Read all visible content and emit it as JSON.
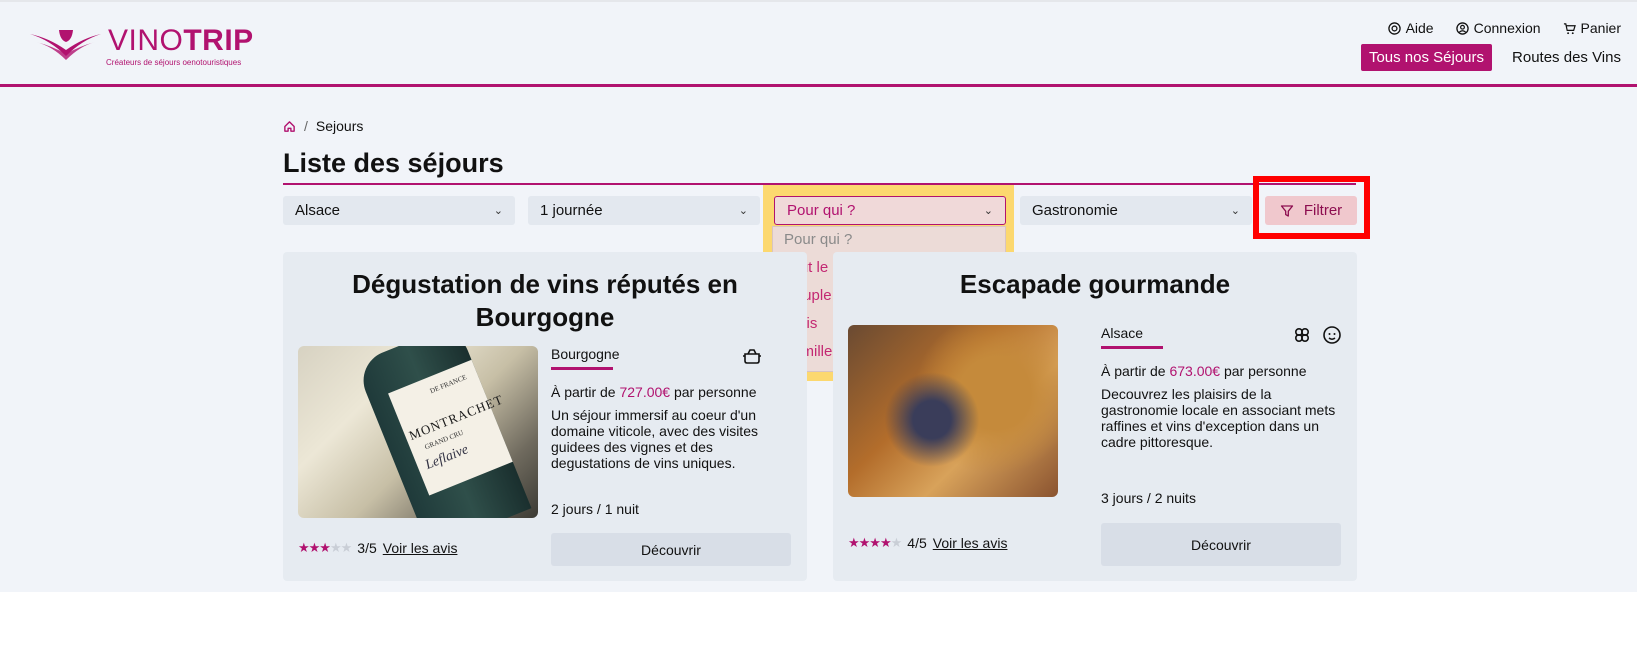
{
  "brand": {
    "name_light": "VINO",
    "name_bold": "TRIP",
    "tagline": "Créateurs de séjours oenotouristiques",
    "color": "#b1126f"
  },
  "top_links": [
    {
      "icon": "help-icon",
      "label": "Aide"
    },
    {
      "icon": "user-icon",
      "label": "Connexion"
    },
    {
      "icon": "cart-icon",
      "label": "Panier"
    }
  ],
  "main_nav": [
    {
      "label": "Tous nos Séjours",
      "active": true
    },
    {
      "label": "Routes des Vins",
      "active": false
    }
  ],
  "breadcrumb": {
    "home_icon": "home-icon",
    "separator": "/",
    "current": "Sejours"
  },
  "page_title": "Liste des séjours",
  "filters": {
    "region": "Alsace",
    "duree": "1 journée",
    "pour_qui": "Pour qui ?",
    "theme": "Gastronomie",
    "submit_label": "Filtrer"
  },
  "pour_qui_options": [
    "Pour qui ?",
    "Tout le monde",
    "Couple",
    "Amis",
    "Famille"
  ],
  "cards": [
    {
      "title": "Dégustation de vins réputés en Bourgogne",
      "region": "Bourgogne",
      "price_prefix": "À partir de",
      "price": "727.00€",
      "price_suffix": "par personne",
      "description": "Un séjour immersif au coeur d'un domaine viticole, avec des visites guidees des vignes et des degustations de vins uniques.",
      "duration": "2 jours / 1 nuit",
      "rating": 3,
      "rating_label": "3/5",
      "reviews_label": "Voir les avis",
      "cta": "Découvrir",
      "photo_label": {
        "top": "DE FRANCE",
        "name": "MONTRACHET",
        "sub": "GRAND CRU",
        "signature": "Leflaive"
      }
    },
    {
      "title": "Escapade gourmande",
      "region": "Alsace",
      "price_prefix": "À partir de",
      "price": "673.00€",
      "price_suffix": "par personne",
      "description": "Decouvrez les plaisirs de la gastronomie locale en associant mets raffines et vins d'exception dans un cadre pittoresque.",
      "duration": "3 jours / 2 nuits",
      "rating": 4,
      "rating_label": "4/5",
      "reviews_label": "Voir les avis",
      "cta": "Découvrir"
    }
  ],
  "colors": {
    "accent": "#b1126f",
    "highlight": "#fcd86f",
    "annotation": "#ff0000"
  }
}
